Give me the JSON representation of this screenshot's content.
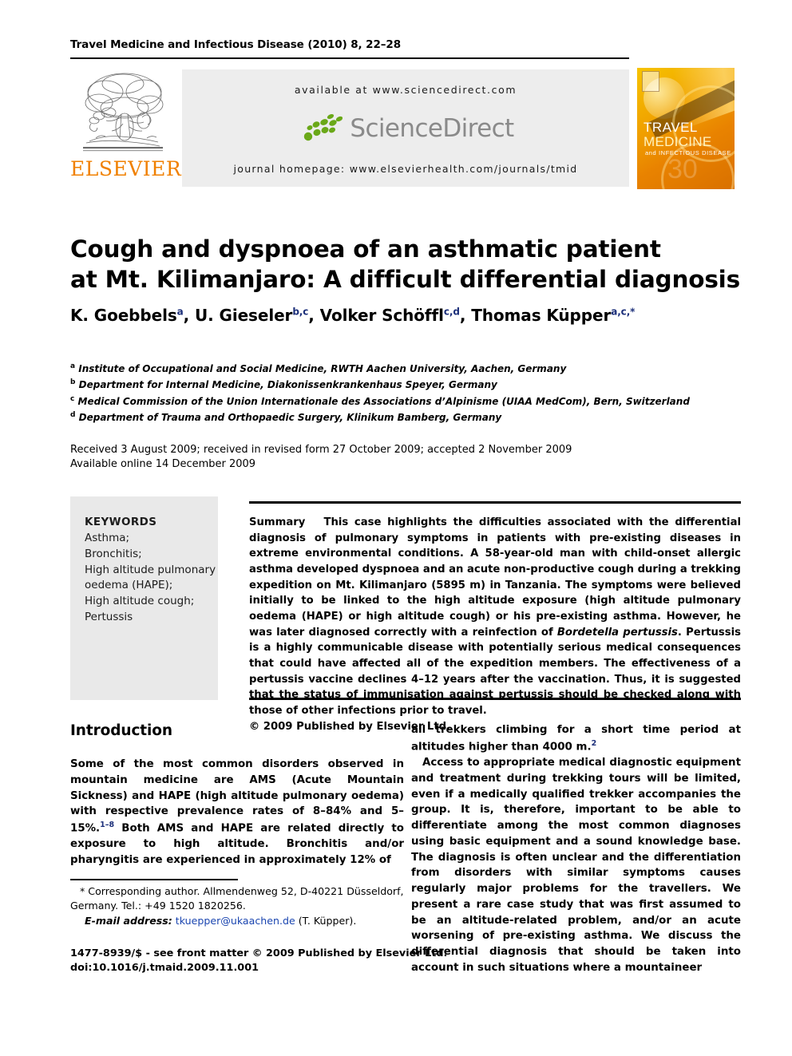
{
  "running_head": "Travel Medicine and Infectious Disease (2010) 8, 22–28",
  "masthead": {
    "publisher_name": "ELSEVIER",
    "available_at": "available at www.sciencedirect.com",
    "sciencedirect_wordmark": "ScienceDirect",
    "journal_homepage": "journal homepage: www.elsevierhealth.com/journals/tmid",
    "cover": {
      "line1": "TRAVEL",
      "line2": "MEDICINE",
      "line3": "and INFECTIOUS DISEASE",
      "volume_watermark": "30"
    }
  },
  "article": {
    "title": "Cough and dyspnoea of an asthmatic patient at Mt. Kilimanjaro: A difficult differential diagnosis",
    "title_line1": "Cough and dyspnoea of an asthmatic patient",
    "title_line2": "at Mt. Kilimanjaro: A difficult differential diagnosis",
    "authors": [
      {
        "name": "K. Goebbels",
        "marks": "a"
      },
      {
        "name": "U. Gieseler",
        "marks": "b,c"
      },
      {
        "name": "Volker Schöffl",
        "marks": "c,d"
      },
      {
        "name": "Thomas Küpper",
        "marks": "a,c,*"
      }
    ],
    "affiliations": [
      {
        "mark": "a",
        "text": "Institute of Occupational and Social Medicine, RWTH Aachen University, Aachen, Germany"
      },
      {
        "mark": "b",
        "text": "Department for Internal Medicine, Diakonissenkrankenhaus Speyer, Germany"
      },
      {
        "mark": "c",
        "text": "Medical Commission of the Union Internationale des Associations d’Alpinisme (UIAA MedCom), Bern, Switzerland"
      },
      {
        "mark": "d",
        "text": "Department of Trauma and Orthopaedic Surgery, Klinikum Bamberg, Germany"
      }
    ],
    "history_line1": "Received 3 August 2009; received in revised form 27 October 2009; accepted 2 November 2009",
    "history_line2": "Available online 14 December 2009"
  },
  "keywords": {
    "heading": "KEYWORDS",
    "items": [
      "Asthma;",
      "Bronchitis;",
      "High altitude pulmonary",
      "oedema (HAPE);",
      "High altitude cough;",
      "Pertussis"
    ]
  },
  "abstract": {
    "label": "Summary",
    "text_part1": "This case highlights the difficulties associated with the differential diagnosis of pulmonary symptoms in patients with pre-existing diseases in extreme environmental conditions. A 58-year-old man with child-onset allergic asthma developed dyspnoea and an acute non-productive cough during a trekking expedition on Mt. Kilimanjaro (5895 m) in Tanzania. The symptoms were believed initially to be linked to the high altitude exposure (high altitude pulmonary oedema (HAPE) or high altitude cough) or his pre-existing asthma. However, he was later diagnosed correctly with a reinfection of ",
    "italic_term": "Bordetella pertussis",
    "text_part2": ". Pertussis is a highly communicable disease with potentially serious medical consequences that could have affected all of the expedition members. The effectiveness of a pertussis vaccine declines 4–12 years after the vaccination. Thus, it is suggested that the status of immunisation against pertussis should be checked along with those of other infections prior to travel.",
    "copyright": "© 2009 Published by Elsevier Ltd."
  },
  "body": {
    "section_heading": "Introduction",
    "left_par1_a": "Some of the most common disorders observed in mountain medicine are AMS (Acute Mountain Sickness) and HAPE (high altitude pulmonary oedema) with respective prevalence rates of 8–84% and 5–15%.",
    "left_par1_cite": "1–8",
    "left_par1_b": " Both AMS and HAPE are related directly to exposure to high altitude. Bronchitis and/or pharyngitis are experienced in approximately 12% of",
    "right_par1_a": "all trekkers climbing for a short time period at altitudes higher than 4000 m.",
    "right_par1_cite": "2",
    "right_par2": "Access to appropriate medical diagnostic equipment and treatment during trekking tours will be limited, even if a medically qualified trekker accompanies the group. It is, therefore, important to be able to differentiate among the most common diagnoses using basic equipment and a sound knowledge base. The diagnosis is often unclear and the differentiation from disorders with similar symptoms causes regularly major problems for the travellers. We present a rare case study that was first assumed to be an altitude-related problem, and/or an acute worsening of pre-existing asthma. We discuss the differential diagnosis that should be taken into account in such situations where a mountaineer"
  },
  "footnotes": {
    "corresponding": "* Corresponding author. Allmendenweg 52, D-40221 Düsseldorf, Germany. Tel.: +49 1520 1820256.",
    "email_label": "E-mail address:",
    "email_value": "tkuepper@ukaachen.de",
    "email_suffix": "(T. Küpper)."
  },
  "imprint": {
    "line1": "1477-8939/$ - see front matter © 2009 Published by Elsevier Ltd.",
    "line2": "doi:10.1016/j.tmaid.2009.11.001"
  },
  "colors": {
    "accent_orange": "#F08000",
    "link_blue": "#1a45b0",
    "superscript_blue": "#1c2f7a",
    "banner_grey": "#ededed",
    "keyword_grey": "#e9e9e9",
    "sciencedirect_green": "#6aa818",
    "sciencedirect_grey": "#8a8a8a"
  }
}
